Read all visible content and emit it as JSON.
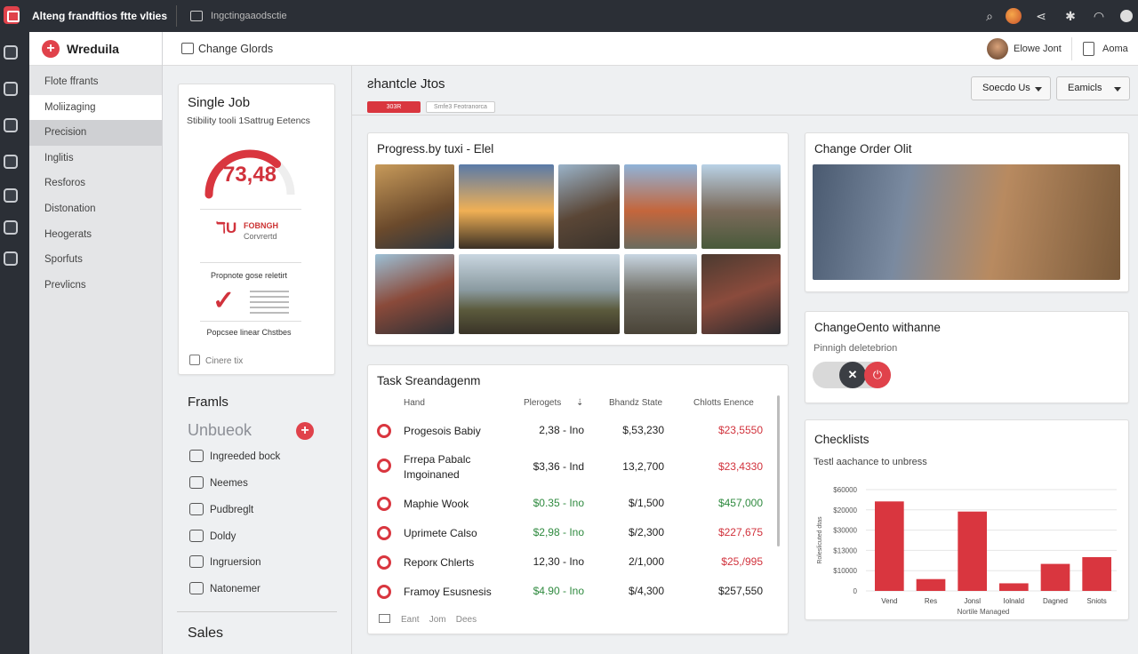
{
  "topbar": {
    "title": "Alteng frandftios ftte vlties",
    "path": "Ingctingaaodsctie"
  },
  "sidebar": {
    "brand": "Wreduila",
    "items": [
      {
        "label": "Flote ffrants"
      },
      {
        "label": "Moliizaging"
      },
      {
        "label": "Precision"
      },
      {
        "label": "Inglitis"
      },
      {
        "label": "Resforos"
      },
      {
        "label": "Distonation"
      },
      {
        "label": "Heogerats"
      },
      {
        "label": "Sporfuts"
      },
      {
        "label": "Prevlicns"
      }
    ]
  },
  "header": {
    "label": "Change Glords",
    "user_name": "Elowe Jont",
    "user_label": "Aoma"
  },
  "single_job": {
    "title": "Single Job",
    "subtitle": "Stibility tooli 1Sattrug Eetencs",
    "gauge_value": "73,48",
    "gauge_fill": 0.73,
    "rlogo": "ℸU",
    "rtext1": "FOBNGH",
    "rtext2": "Corvrertd",
    "prompt1": "Propnote gose reletirt",
    "prompt2": "Popcsee linear Chstbes",
    "footer": "Cinere tix"
  },
  "left": {
    "frames_title": "Framls",
    "unbook_title": "Unbueok",
    "items": [
      {
        "label": "Ingreeded bock"
      },
      {
        "label": "Neemes"
      },
      {
        "label": "Pudbreglt"
      },
      {
        "label": "Doldy"
      },
      {
        "label": "Ingruersion"
      },
      {
        "label": "Natonemer"
      }
    ],
    "sales_title": "Sales"
  },
  "main": {
    "title": "ƨhantcle Jtos",
    "tag1": "303R",
    "tag2": "Smfe3 Feotranorca",
    "btn1": "Soecdo Us",
    "btn2": "Eamicls"
  },
  "progress": {
    "title": "Progress.by tuxi - Elel"
  },
  "change_order": {
    "title": "Change Order Olit"
  },
  "task": {
    "title": "Task Sreandagenm",
    "headers": [
      "Hand",
      "Plerogets",
      "Bhandz State",
      "Chlotts Enence"
    ],
    "header_sort": "⇣",
    "rows": [
      {
        "name": "Progesois Babiy",
        "c2": "2,38 - Ino",
        "c3": "$,53,230",
        "c4": "$23,5550",
        "c2c": "",
        "c4c": "red"
      },
      {
        "name": "Frrepa Pabalc\nImgoinaned",
        "c2": "$3,36 - Ind",
        "c3": "13,2,700",
        "c4": "$23,4330",
        "c2c": "",
        "c4c": "red"
      },
      {
        "name": "Maphie Wook",
        "c2": "$0.35 - Ino",
        "c3": "$/1,500",
        "c4": "$457,000",
        "c2c": "green",
        "c4c": "green"
      },
      {
        "name": "Uprimete Calso",
        "c2": "$2,98 - Ino",
        "c3": "$/2,300",
        "c4": "$227,675",
        "c2c": "green",
        "c4c": "red"
      },
      {
        "name": "Reporк Chlerts",
        "c2": "12,30 - Ino",
        "c3": "2/1,000",
        "c4": "$25,/995",
        "c2c": "",
        "c4c": "red"
      },
      {
        "name": "Framoy Esusnesis",
        "c2": "$4.90 - Ino",
        "c3": "$/4,300",
        "c4": "$257,550",
        "c2c": "green",
        "c4c": ""
      }
    ],
    "footer": [
      "Eant",
      "Jom",
      "Dees"
    ]
  },
  "change_client": {
    "title": "ChangeOento withanne",
    "subtitle": "Pinnigh deletebrion"
  },
  "checklists": {
    "title": "Checklists",
    "subtitle": "Testl aachance to unbress"
  },
  "colors": {
    "accent": "#d9363f",
    "green": "#2f8a3f",
    "dark": "#2b2f36"
  },
  "chart_data": {
    "type": "bar",
    "title": "",
    "categories": [
      "Vend",
      "Res",
      "Jonsl",
      "Iolnald",
      "Dagned",
      "Sniots"
    ],
    "values": [
      53000,
      7000,
      47000,
      4500,
      16000,
      20000
    ],
    "ylabel": "Roleslicuted dtas",
    "xlabel": "Nortile Managed",
    "ytick_labels": [
      "$60000",
      "$20000",
      "$30000",
      "$13000",
      "$10000",
      "0"
    ],
    "ylim": [
      0,
      60000
    ],
    "color": "#d9363f"
  }
}
